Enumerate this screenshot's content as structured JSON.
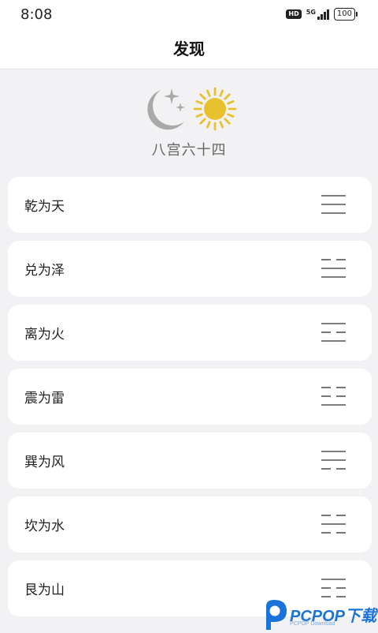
{
  "status_bar": {
    "time": "8:08",
    "hd_badge": "HD",
    "network": "5G",
    "signal_bars": 4,
    "battery": "100"
  },
  "header": {
    "title": "发现"
  },
  "hero": {
    "icons": [
      "moon-stars-icon",
      "sun-icon"
    ],
    "caption": "八宫六十四"
  },
  "items": [
    {
      "label": "乾为天",
      "lines": [
        "yang",
        "yang",
        "yang"
      ]
    },
    {
      "label": "兑为泽",
      "lines": [
        "yin",
        "yang",
        "yang"
      ]
    },
    {
      "label": "离为火",
      "lines": [
        "yang",
        "yin",
        "yang"
      ]
    },
    {
      "label": "震为雷",
      "lines": [
        "yin",
        "yin",
        "yang"
      ]
    },
    {
      "label": "巽为风",
      "lines": [
        "yang",
        "yang",
        "yin"
      ]
    },
    {
      "label": "坎为水",
      "lines": [
        "yin",
        "yang",
        "yin"
      ]
    },
    {
      "label": "艮为山",
      "lines": [
        "yang",
        "yin",
        "yin"
      ]
    }
  ],
  "watermark": {
    "logo": "pcpop-logo",
    "text": "PCPOP下载",
    "sub": "PCPOP Download"
  },
  "colors": {
    "background": "#f2f2f4",
    "card": "#ffffff",
    "sun": "#e8c12e",
    "moon": "#a9a9a9",
    "watermark": "#1a73d9"
  }
}
